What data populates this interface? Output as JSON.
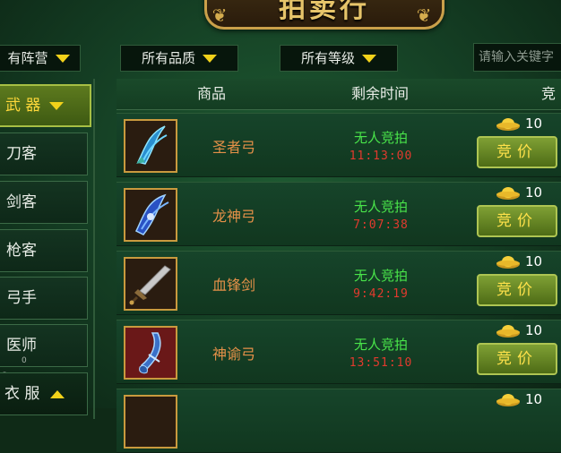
{
  "banner": {
    "title": "拍卖行"
  },
  "filters": {
    "faction": "有阵营",
    "quality": "所有品质",
    "level": "所有等级",
    "search_placeholder": "请输入关键字"
  },
  "sidebar": {
    "category": "武 器",
    "items": [
      {
        "label": "刀客"
      },
      {
        "label": "剑客"
      },
      {
        "label": "枪客"
      },
      {
        "label": "弓手"
      },
      {
        "label": "医师"
      }
    ],
    "bottom_category": "衣 服",
    "small_marks": [
      "S",
      "0"
    ]
  },
  "table": {
    "headers": {
      "item": "商品",
      "time": "剩余时间",
      "bid": "竞"
    },
    "rows": [
      {
        "name": "圣者弓",
        "status": "无人竞拍",
        "time": "11:13:00",
        "price": "10",
        "button": "竞价",
        "icon": "bow-icon"
      },
      {
        "name": "龙神弓",
        "status": "无人竞拍",
        "time": "7:07:38",
        "price": "10",
        "button": "竞价",
        "icon": "bow-icon"
      },
      {
        "name": "血锋剑",
        "status": "无人竞拍",
        "time": "9:42:19",
        "price": "10",
        "button": "竞价",
        "icon": "sword-icon"
      },
      {
        "name": "神谕弓",
        "status": "无人竞拍",
        "time": "13:51:10",
        "price": "10",
        "button": "竞价",
        "icon": "bow-icon"
      }
    ],
    "partial_row": {
      "price": "10"
    }
  },
  "colors": {
    "accent_gold": "#e6c46a",
    "status_green": "#49e44a",
    "timer_red": "#e23a2e",
    "item_orange": "#e49048",
    "button_green": "#6a8c26"
  }
}
